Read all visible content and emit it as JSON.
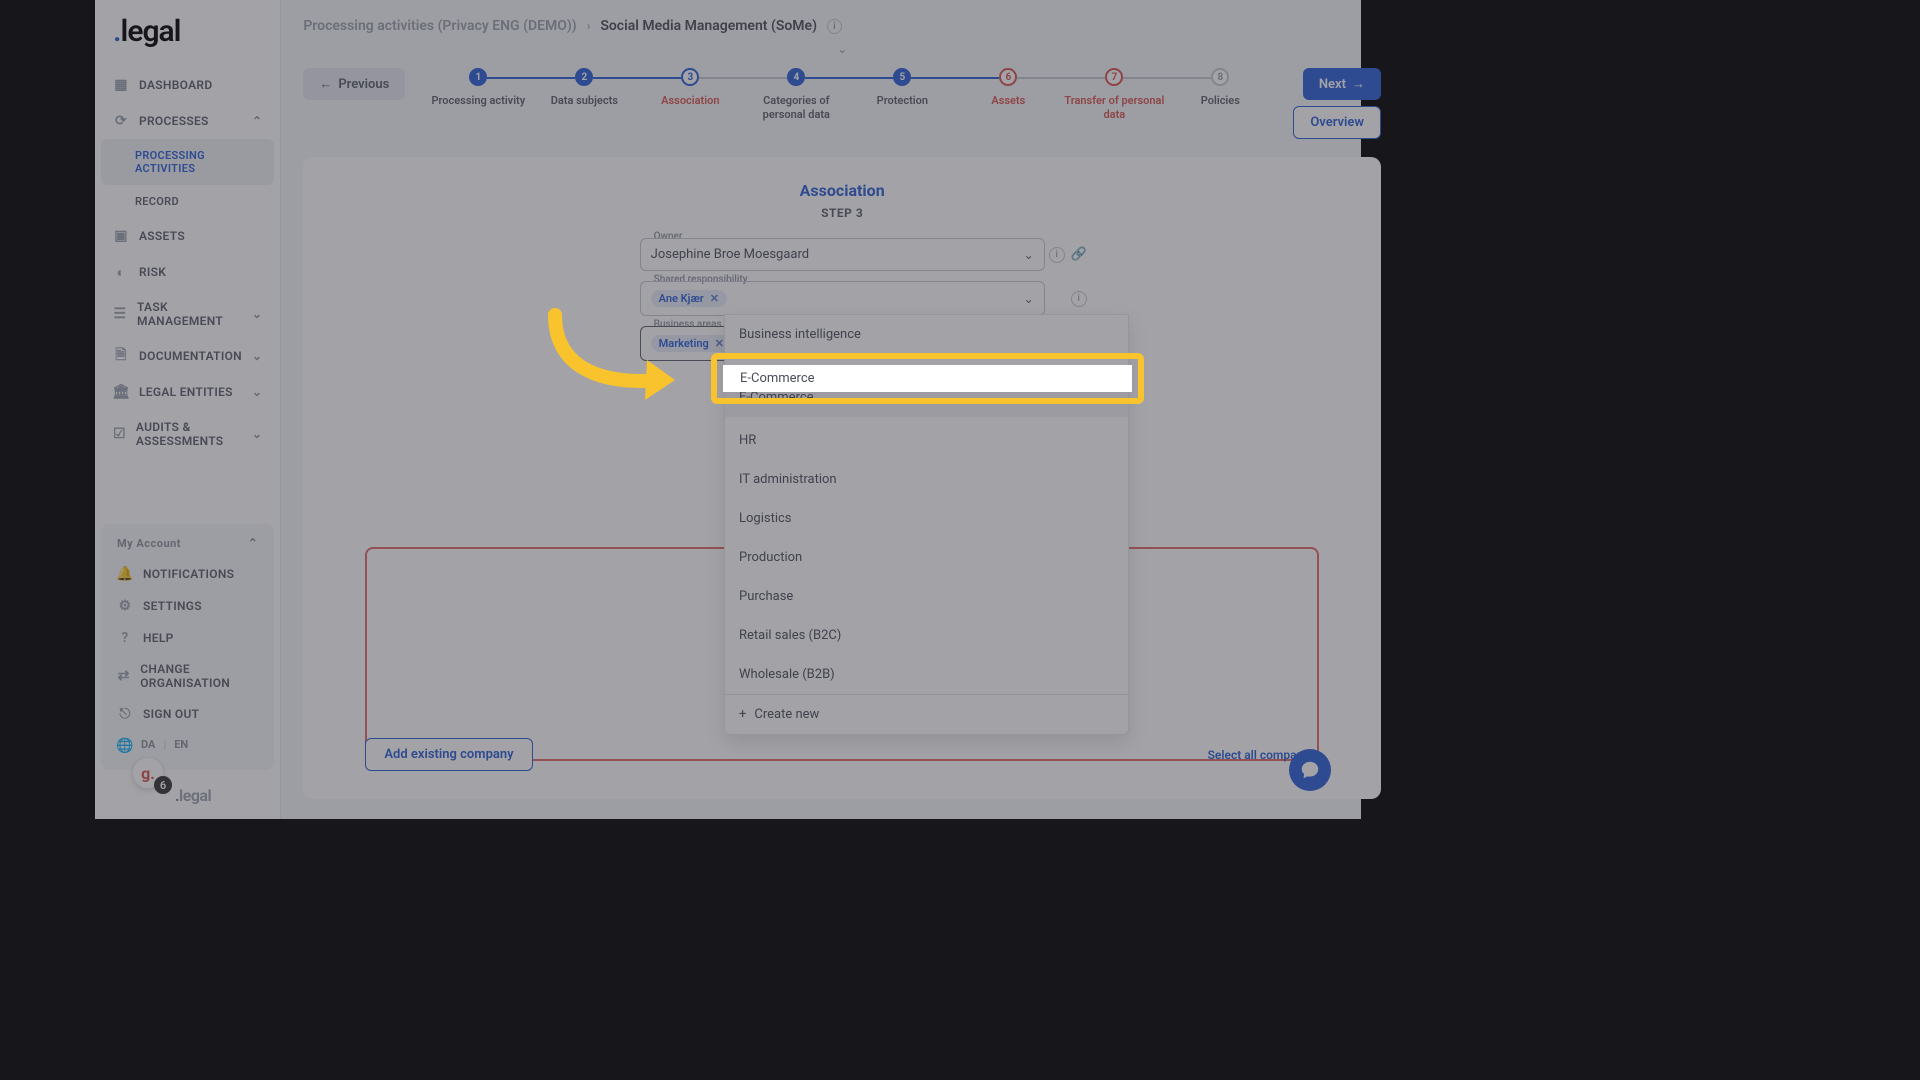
{
  "logo": ".legal",
  "sidebar": {
    "items": [
      {
        "label": "Dashboard"
      },
      {
        "label": "Processes",
        "expanded": true
      },
      {
        "label": "Processing Activities",
        "sub": true,
        "active": true
      },
      {
        "label": "Record",
        "sub": true
      },
      {
        "label": "Assets"
      },
      {
        "label": "Risk"
      },
      {
        "label": "Task Management",
        "caret": true
      },
      {
        "label": "Documentation",
        "caret": true
      },
      {
        "label": "Legal Entities",
        "caret": true
      },
      {
        "label": "Audits & Assessments",
        "caret": true
      }
    ]
  },
  "account": {
    "title": "My Account",
    "items": [
      {
        "label": "Notifications"
      },
      {
        "label": "Settings"
      },
      {
        "label": "Help"
      },
      {
        "label": "Change Organisation"
      },
      {
        "label": "Sign Out"
      }
    ],
    "lang": {
      "da": "DA",
      "en": "EN",
      "sep": "|"
    }
  },
  "g_badge": {
    "letter": "g.",
    "count": "6"
  },
  "breadcrumb": {
    "a": "Processing activities (Privacy ENG (DEMO))",
    "b": "Social Media Management (SoMe)"
  },
  "buttons": {
    "previous": "Previous",
    "next": "Next",
    "overview": "Overview",
    "add_existing": "Add existing company",
    "select_all": "Select all companies"
  },
  "steps": [
    {
      "num": "1",
      "label": "Processing activity",
      "state": "done"
    },
    {
      "num": "2",
      "label": "Data subjects",
      "state": "done"
    },
    {
      "num": "3",
      "label": "Association",
      "state": "current"
    },
    {
      "num": "4",
      "label": "Categories of personal data",
      "state": "done"
    },
    {
      "num": "5",
      "label": "Protection",
      "state": "done"
    },
    {
      "num": "6",
      "label": "Assets",
      "state": "incomplete"
    },
    {
      "num": "7",
      "label": "Transfer of personal data",
      "state": "incomplete"
    },
    {
      "num": "8",
      "label": "Policies",
      "state": "future"
    }
  ],
  "page": {
    "title": "Association",
    "step": "Step 3"
  },
  "fields": {
    "owner": {
      "label": "Owner",
      "value": "Josephine Broe Moesgaard"
    },
    "shared": {
      "label": "Shared responsibility",
      "chip": "Ane Kjær"
    },
    "business": {
      "label": "Business areas",
      "chip": "Marketing"
    }
  },
  "dropdown": {
    "options": [
      "Business intelligence",
      "",
      "E-Commerce",
      "",
      "HR",
      "IT administration",
      "Logistics",
      "Production",
      "Purchase",
      "Retail sales (B2C)",
      "Wholesale (B2B)"
    ],
    "highlighted": "E-Commerce",
    "create": "Create new"
  },
  "footer_logo": ".legal"
}
